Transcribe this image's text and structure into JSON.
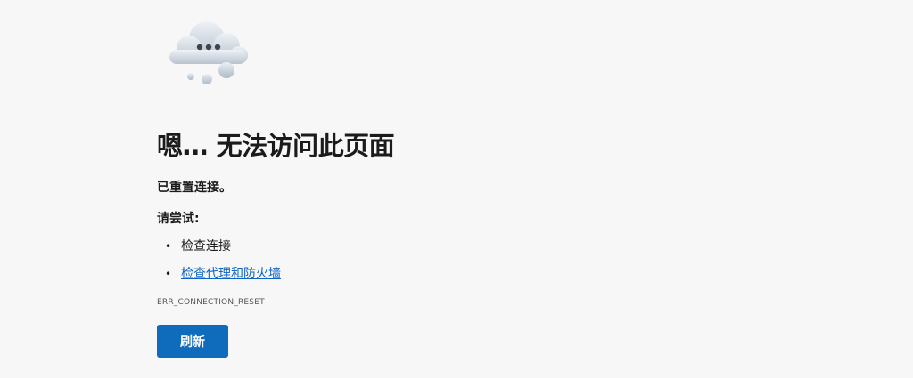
{
  "error_page": {
    "illustration_icon": "thinking-cloud-icon",
    "heading": "嗯… 无法访问此页面",
    "subheading": "已重置连接。",
    "try_label": "请尝试:",
    "suggestions": [
      {
        "label": "检查连接",
        "is_link": false
      },
      {
        "label": "检查代理和防火墙",
        "is_link": true
      }
    ],
    "error_code": "ERR_CONNECTION_RESET",
    "refresh_label": "刷新"
  },
  "colors": {
    "background": "#f7f7f7",
    "button": "#0f6cbd",
    "link": "#0b63c4"
  }
}
